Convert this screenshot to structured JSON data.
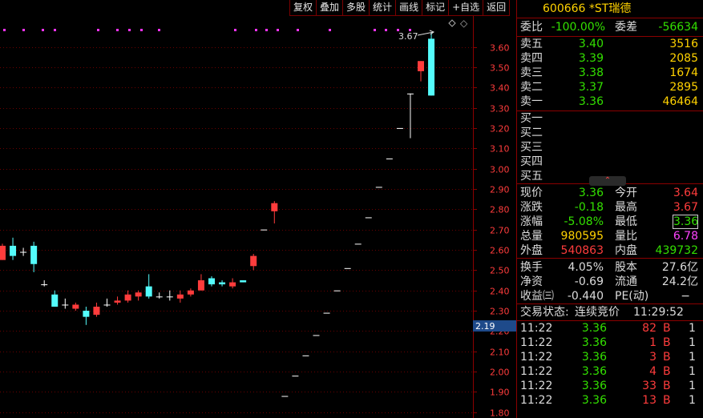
{
  "toolbar": {
    "items": [
      "复权",
      "叠加",
      "多股",
      "统计",
      "画线",
      "标记",
      "+自选",
      "返回"
    ]
  },
  "stock": {
    "code": "600666",
    "name": "*ST瑞德"
  },
  "summary": {
    "wb_label": "委比",
    "wb": "-100.00%",
    "wc_label": "委差",
    "wc": "-56634"
  },
  "asks": [
    {
      "label": "卖五",
      "price": "3.40",
      "vol": "3516"
    },
    {
      "label": "卖四",
      "price": "3.39",
      "vol": "2085"
    },
    {
      "label": "卖三",
      "price": "3.38",
      "vol": "1674"
    },
    {
      "label": "卖二",
      "price": "3.37",
      "vol": "2895"
    },
    {
      "label": "卖一",
      "price": "3.36",
      "vol": "46464"
    }
  ],
  "bids": [
    {
      "label": "买一"
    },
    {
      "label": "买二"
    },
    {
      "label": "买三"
    },
    {
      "label": "买四"
    },
    {
      "label": "买五"
    }
  ],
  "quote": {
    "now_l": "现价",
    "now": "3.36",
    "open_l": "今开",
    "open": "3.64",
    "chg_l": "涨跌",
    "chg": "-0.18",
    "high_l": "最高",
    "high": "3.67",
    "pct_l": "涨幅",
    "pct": "-5.08%",
    "low_l": "最低",
    "low": "3.36",
    "vol_l": "总量",
    "vol": "980595",
    "ratio_l": "量比",
    "ratio": "6.78",
    "out_l": "外盘",
    "out": "540863",
    "in_l": "内盘",
    "in": "439732"
  },
  "fund": {
    "turn_l": "换手",
    "turn": "4.05%",
    "cap_l": "股本",
    "cap": "27.6亿",
    "nav_l": "净资",
    "nav": "-0.69",
    "float_l": "流通",
    "float": "24.2亿",
    "eps_l": "收益㈢",
    "eps": "-0.440",
    "pe_l": "PE(动)",
    "pe": "−"
  },
  "status": {
    "label": "交易状态:",
    "value": "连续竞价",
    "time": "11:29:52"
  },
  "trades": [
    {
      "time": "11:22",
      "price": "3.36",
      "vol": "82",
      "side": "B",
      "n": "1"
    },
    {
      "time": "11:22",
      "price": "3.36",
      "vol": "1",
      "side": "B",
      "n": "1"
    },
    {
      "time": "11:22",
      "price": "3.36",
      "vol": "3",
      "side": "B",
      "n": "1"
    },
    {
      "time": "11:22",
      "price": "3.36",
      "vol": "4",
      "side": "B",
      "n": "1"
    },
    {
      "time": "11:22",
      "price": "3.36",
      "vol": "33",
      "side": "B",
      "n": "1"
    },
    {
      "time": "11:22",
      "price": "3.36",
      "vol": "13",
      "side": "B",
      "n": "1"
    }
  ],
  "chart_data": {
    "type": "candlestick",
    "yticks": [
      "3.60",
      "3.50",
      "3.40",
      "3.30",
      "3.20",
      "3.10",
      "3.00",
      "2.90",
      "2.80",
      "2.70",
      "2.60",
      "2.50",
      "2.40",
      "2.30",
      "2.20",
      "2.10",
      "2.00",
      "1.90",
      "1.80"
    ],
    "current_price_label": "2.19",
    "high_marker": "3.67",
    "candles": [
      {
        "o": 2.55,
        "c": 2.62,
        "h": 2.63,
        "l": 2.55
      },
      {
        "o": 2.62,
        "c": 2.57,
        "h": 2.66,
        "l": 2.55
      },
      {
        "o": 2.59,
        "c": 2.59,
        "h": 2.61,
        "l": 2.57
      },
      {
        "o": 2.62,
        "c": 2.53,
        "h": 2.64,
        "l": 2.49
      },
      {
        "o": 2.43,
        "c": 2.43,
        "h": 2.45,
        "l": 2.42
      },
      {
        "o": 2.38,
        "c": 2.32,
        "h": 2.4,
        "l": 2.32
      },
      {
        "o": 2.33,
        "c": 2.33,
        "h": 2.36,
        "l": 2.31
      },
      {
        "o": 2.31,
        "c": 2.33,
        "h": 2.34,
        "l": 2.3
      },
      {
        "o": 2.3,
        "c": 2.27,
        "h": 2.32,
        "l": 2.23
      },
      {
        "o": 2.28,
        "c": 2.32,
        "h": 2.34,
        "l": 2.27
      },
      {
        "o": 2.33,
        "c": 2.33,
        "h": 2.36,
        "l": 2.32
      },
      {
        "o": 2.34,
        "c": 2.35,
        "h": 2.37,
        "l": 2.33
      },
      {
        "o": 2.35,
        "c": 2.38,
        "h": 2.4,
        "l": 2.34
      },
      {
        "o": 2.37,
        "c": 2.39,
        "h": 2.4,
        "l": 2.35
      },
      {
        "o": 2.42,
        "c": 2.37,
        "h": 2.48,
        "l": 2.36
      },
      {
        "o": 2.37,
        "c": 2.37,
        "h": 2.39,
        "l": 2.36
      },
      {
        "o": 2.37,
        "c": 2.37,
        "h": 2.4,
        "l": 2.35
      },
      {
        "o": 2.36,
        "c": 2.38,
        "h": 2.4,
        "l": 2.34
      },
      {
        "o": 2.38,
        "c": 2.4,
        "h": 2.41,
        "l": 2.37
      },
      {
        "o": 2.4,
        "c": 2.45,
        "h": 2.48,
        "l": 2.4
      },
      {
        "o": 2.46,
        "c": 2.43,
        "h": 2.47,
        "l": 2.42
      },
      {
        "o": 2.44,
        "c": 2.43,
        "h": 2.45,
        "l": 2.42
      },
      {
        "o": 2.42,
        "c": 2.44,
        "h": 2.46,
        "l": 2.41
      },
      {
        "o": 2.45,
        "c": 2.44,
        "h": 2.45,
        "l": 2.44
      },
      {
        "o": 2.52,
        "c": 2.57,
        "h": 2.58,
        "l": 2.5
      },
      {
        "o": 2.7,
        "c": 2.7,
        "h": 2.7,
        "l": 2.7
      },
      {
        "o": 2.79,
        "c": 2.83,
        "h": 2.84,
        "l": 2.73
      },
      {
        "o": 1.88,
        "c": 1.88,
        "h": 1.88,
        "l": 1.88
      },
      {
        "o": 1.98,
        "c": 1.98,
        "h": 1.98,
        "l": 1.98
      },
      {
        "o": 2.08,
        "c": 2.08,
        "h": 2.08,
        "l": 2.08
      },
      {
        "o": 2.18,
        "c": 2.18,
        "h": 2.18,
        "l": 2.18
      },
      {
        "o": 2.29,
        "c": 2.29,
        "h": 2.29,
        "l": 2.29
      },
      {
        "o": 2.4,
        "c": 2.4,
        "h": 2.4,
        "l": 2.4
      },
      {
        "o": 2.51,
        "c": 2.51,
        "h": 2.51,
        "l": 2.51
      },
      {
        "o": 2.63,
        "c": 2.63,
        "h": 2.63,
        "l": 2.63
      },
      {
        "o": 2.76,
        "c": 2.76,
        "h": 2.76,
        "l": 2.76
      },
      {
        "o": 2.91,
        "c": 2.91,
        "h": 2.91,
        "l": 2.91
      },
      {
        "o": 3.05,
        "c": 3.05,
        "h": 3.05,
        "l": 3.05
      },
      {
        "o": 3.2,
        "c": 3.2,
        "h": 3.2,
        "l": 3.2
      },
      {
        "o": 3.37,
        "c": 3.37,
        "h": 3.37,
        "l": 3.15
      },
      {
        "o": 3.48,
        "c": 3.53,
        "h": 3.53,
        "l": 3.43
      },
      {
        "o": 3.64,
        "c": 3.36,
        "h": 3.67,
        "l": 3.36
      }
    ]
  }
}
